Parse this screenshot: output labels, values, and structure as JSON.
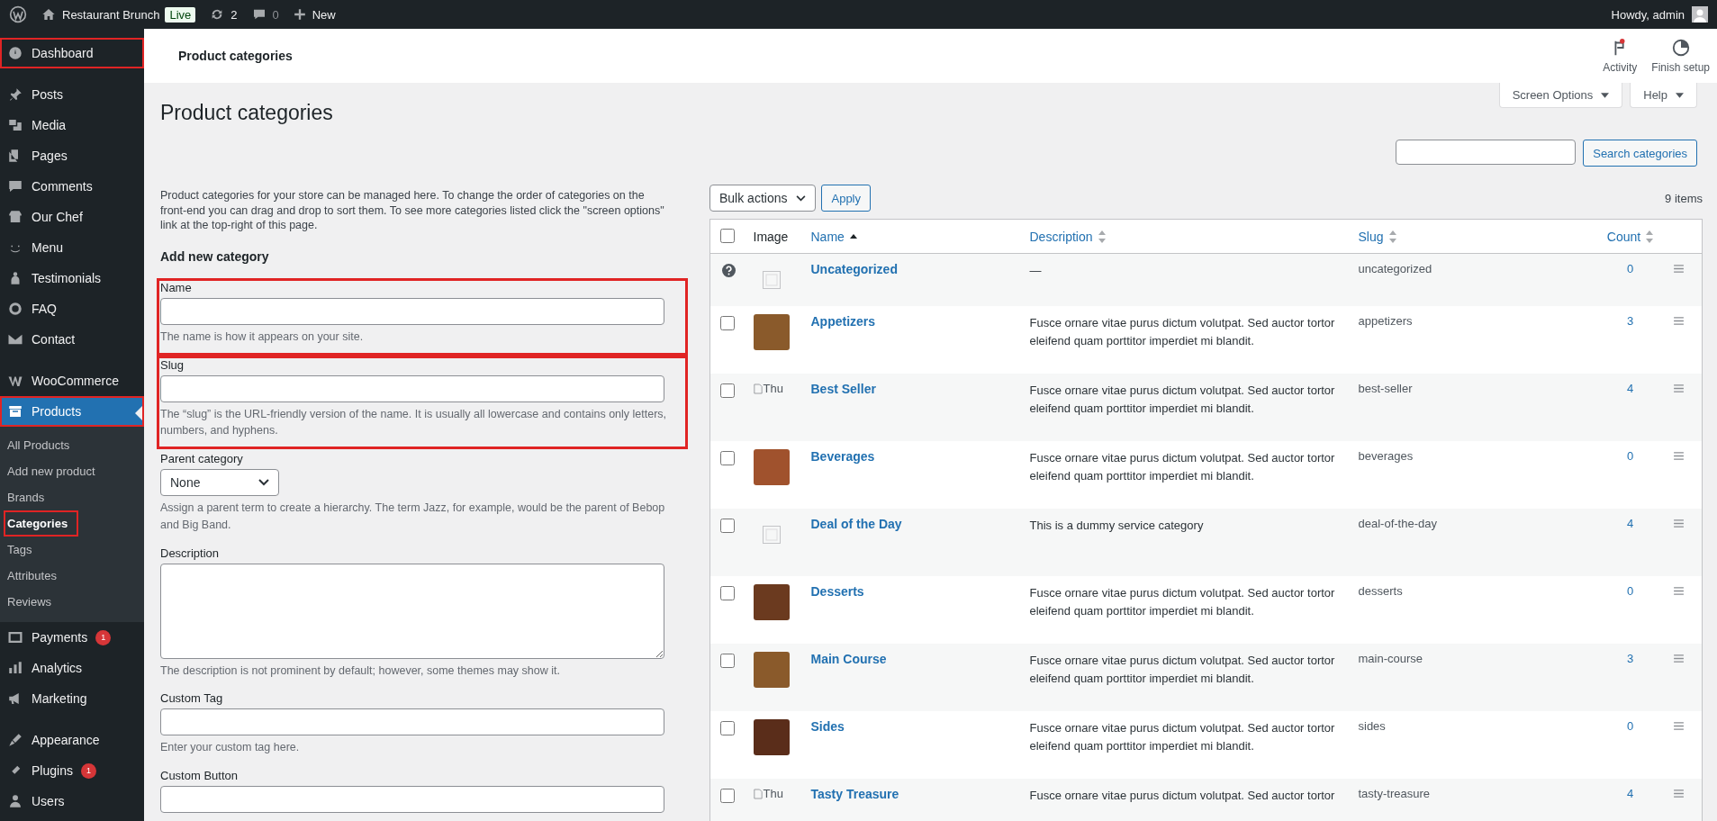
{
  "admin_bar": {
    "site_name": "Restaurant Brunch",
    "live_badge": "Live",
    "updates": "2",
    "comments": "0",
    "new_label": "New",
    "greeting": "Howdy, admin"
  },
  "sidebar": {
    "groups": [
      [
        {
          "label": "Dashboard",
          "highlighted": true,
          "current": false
        }
      ],
      [
        {
          "label": "Posts",
          "highlighted": false,
          "current": false
        },
        {
          "label": "Media",
          "highlighted": false,
          "current": false
        },
        {
          "label": "Pages",
          "highlighted": false,
          "current": false
        },
        {
          "label": "Comments",
          "highlighted": false,
          "current": false
        },
        {
          "label": "Our Chef",
          "highlighted": false,
          "current": false
        },
        {
          "label": "Menu",
          "highlighted": false,
          "current": false
        },
        {
          "label": "Testimonials",
          "highlighted": false,
          "current": false
        },
        {
          "label": "FAQ",
          "highlighted": false,
          "current": false
        },
        {
          "label": "Contact",
          "highlighted": false,
          "current": false
        }
      ],
      [
        {
          "label": "WooCommerce",
          "highlighted": false,
          "current": false
        },
        {
          "label": "Products",
          "highlighted": true,
          "current": true,
          "children": [
            {
              "label": "All Products",
              "selected": false,
              "highlighted": false
            },
            {
              "label": "Add new product",
              "selected": false,
              "highlighted": false
            },
            {
              "label": "Brands",
              "selected": false,
              "highlighted": false
            },
            {
              "label": "Categories",
              "selected": true,
              "highlighted": true
            },
            {
              "label": "Tags",
              "selected": false,
              "highlighted": false
            },
            {
              "label": "Attributes",
              "selected": false,
              "highlighted": false
            },
            {
              "label": "Reviews",
              "selected": false,
              "highlighted": false
            }
          ]
        },
        {
          "label": "Payments",
          "badge": "1",
          "highlighted": false,
          "current": false
        },
        {
          "label": "Analytics",
          "highlighted": false,
          "current": false
        },
        {
          "label": "Marketing",
          "highlighted": false,
          "current": false
        }
      ],
      [
        {
          "label": "Appearance",
          "highlighted": false,
          "current": false
        },
        {
          "label": "Plugins",
          "badge": "1",
          "highlighted": false,
          "current": false
        },
        {
          "label": "Users",
          "highlighted": false,
          "current": false
        }
      ]
    ]
  },
  "header": {
    "title": "Product categories",
    "actions": [
      {
        "label": "Activity",
        "notification": true
      },
      {
        "label": "Finish setup",
        "notification": false
      }
    ]
  },
  "screen_tabs": [
    {
      "label": "Screen Options"
    },
    {
      "label": "Help"
    }
  ],
  "page_title": "Product categories",
  "search": {
    "button": "Search categories"
  },
  "form": {
    "intro": "Product categories for your store can be managed here. To change the order of categories on the front-end you can drag and drop to sort them. To see more categories listed click the \"screen options\" link at the top-right of this page.",
    "heading": "Add new category",
    "fields": [
      {
        "kind": "text",
        "label": "Name",
        "hint": "The name is how it appears on your site.",
        "highlighted": true
      },
      {
        "kind": "text",
        "label": "Slug",
        "hint": "The “slug” is the URL-friendly version of the name. It is usually all lowercase and contains only letters, numbers, and hyphens.",
        "highlighted": true
      },
      {
        "kind": "select",
        "label": "Parent category",
        "value": "None",
        "hint": "Assign a parent term to create a hierarchy. The term Jazz, for example, would be the parent of Bebop and Big Band.",
        "highlighted": false
      },
      {
        "kind": "textarea",
        "label": "Description",
        "hint": "The description is not prominent by default; however, some themes may show it.",
        "highlighted": false
      },
      {
        "kind": "text",
        "label": "Custom Tag",
        "hint": "Enter your custom tag here.",
        "highlighted": false
      },
      {
        "kind": "text",
        "label": "Custom Button",
        "highlighted": false
      }
    ]
  },
  "table": {
    "select_all_checked": false,
    "bulk_actions": "Bulk actions",
    "apply": "Apply",
    "item_count": "9 items",
    "columns": [
      {
        "label": "Image",
        "sortable": false,
        "sorted": false
      },
      {
        "label": "Name",
        "sortable": true,
        "sorted": true
      },
      {
        "label": "Description",
        "sortable": true,
        "sorted": false
      },
      {
        "label": "Slug",
        "sortable": true,
        "sorted": false
      },
      {
        "label": "Count",
        "sortable": true,
        "sorted": false
      }
    ],
    "rows": [
      {
        "kind": "default",
        "image": {
          "kind": "placeholder"
        },
        "name": "Uncategorized",
        "description": "—",
        "slug": "uncategorized",
        "count": "0"
      },
      {
        "kind": "category",
        "checked": false,
        "image": {
          "kind": "photo"
        },
        "name": "Appetizers",
        "description": "Fusce ornare vitae purus dictum volutpat. Sed auctor tortor eleifend quam porttitor imperdiet mi blandit.",
        "slug": "appetizers",
        "count": "3"
      },
      {
        "kind": "category",
        "checked": false,
        "image": {
          "kind": "broken",
          "alt_text": "Thu"
        },
        "name": "Best Seller",
        "description": "Fusce ornare vitae purus dictum volutpat. Sed auctor tortor eleifend quam porttitor imperdiet mi blandit.",
        "slug": "best-seller",
        "count": "4"
      },
      {
        "kind": "category",
        "checked": false,
        "image": {
          "kind": "photo"
        },
        "name": "Beverages",
        "description": "Fusce ornare vitae purus dictum volutpat. Sed auctor tortor eleifend quam porttitor imperdiet mi blandit.",
        "slug": "beverages",
        "count": "0"
      },
      {
        "kind": "category",
        "checked": false,
        "image": {
          "kind": "placeholder"
        },
        "name": "Deal of the Day",
        "description": "This is a dummy service category",
        "slug": "deal-of-the-day",
        "count": "4"
      },
      {
        "kind": "category",
        "checked": false,
        "image": {
          "kind": "photo"
        },
        "name": "Desserts",
        "description": "Fusce ornare vitae purus dictum volutpat. Sed auctor tortor eleifend quam porttitor imperdiet mi blandit.",
        "slug": "desserts",
        "count": "0"
      },
      {
        "kind": "category",
        "checked": false,
        "image": {
          "kind": "photo"
        },
        "name": "Main Course",
        "description": "Fusce ornare vitae purus dictum volutpat. Sed auctor tortor eleifend quam porttitor imperdiet mi blandit.",
        "slug": "main-course",
        "count": "3"
      },
      {
        "kind": "category",
        "checked": false,
        "image": {
          "kind": "photo"
        },
        "name": "Sides",
        "description": "Fusce ornare vitae purus dictum volutpat. Sed auctor tortor eleifend quam porttitor imperdiet mi blandit.",
        "slug": "sides",
        "count": "0"
      },
      {
        "kind": "category",
        "checked": false,
        "image": {
          "kind": "broken",
          "alt_text": "Thu"
        },
        "name": "Tasty Treasure",
        "description": "Fusce ornare vitae purus dictum volutpat. Sed auctor tortor",
        "slug": "tasty-treasure",
        "count": "4"
      }
    ]
  }
}
